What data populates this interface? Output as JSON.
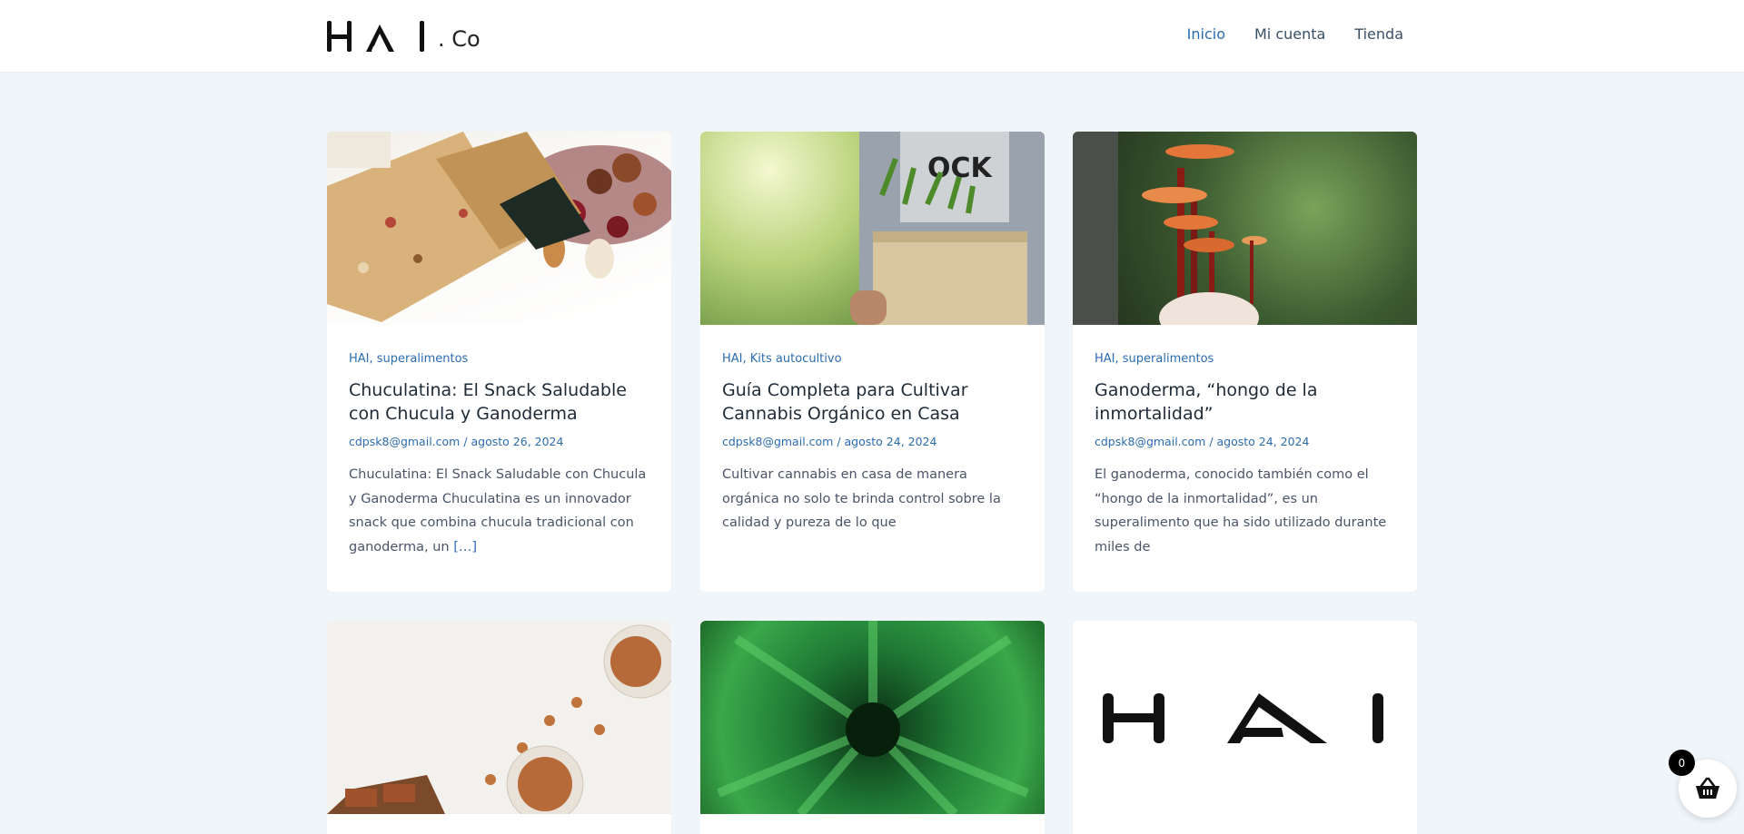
{
  "header": {
    "logo_suffix": ". Co",
    "nav": [
      {
        "label": "Inicio",
        "active": true
      },
      {
        "label": "Mi cuenta",
        "active": false
      },
      {
        "label": "Tienda",
        "active": false
      }
    ]
  },
  "posts": [
    {
      "categories": [
        "HAI",
        "superalimentos"
      ],
      "title": "Chuculatina: El Snack Saludable con Chucula y Ganoderma",
      "author": "cdpsk8@gmail.com",
      "date": "agosto 26, 2024",
      "excerpt": "Chuculatina: El Snack Saludable con Chucula y Ganoderma Chuculatina es un innovador snack que combina chucula tradicional con ganoderma, un",
      "more": "[…]"
    },
    {
      "categories": [
        "HAI",
        "Kits autocultivo"
      ],
      "title": "Guía Completa para Cultivar Cannabis Orgánico en Casa",
      "author": "cdpsk8@gmail.com",
      "date": "agosto 24, 2024",
      "excerpt": "Cultivar cannabis en casa de manera orgánica no solo te brinda control sobre la calidad y pureza de lo que"
    },
    {
      "categories": [
        "HAI",
        "superalimentos"
      ],
      "title": "Ganoderma, “hongo de la inmortalidad”",
      "author": "cdpsk8@gmail.com",
      "date": "agosto 24, 2024",
      "excerpt": "El ganoderma, conocido también como el “hongo de la inmortalidad”, es un superalimento que ha sido utilizado durante miles de"
    }
  ],
  "cart": {
    "count": "0"
  }
}
